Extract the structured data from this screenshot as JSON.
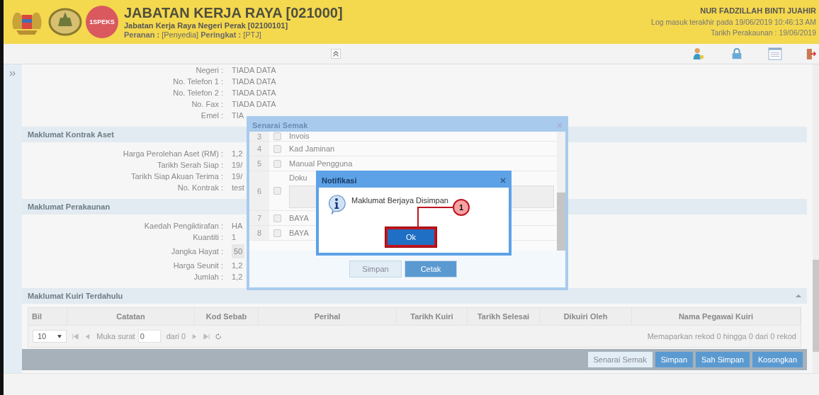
{
  "header": {
    "logo_text": "1SPEKS",
    "title": "JABATAN KERJA RAYA [021000]",
    "subtitle": "Jabatan Kerja Raya Negeri Perak [02100101]",
    "role_line": "**Peranan :** [Penyedia] **Peringkat :** [PTJ]",
    "user": "NUR FADZILLAH BINTI JUAHIR",
    "last_login": "Log masuk terakhir pada 19/06/2019 10:46:13 AM",
    "account_date": "Tarikh Perakaunan : 19/06/2019"
  },
  "sections": [
    {
      "fields": [
        {
          "label": "Negeri :",
          "value": "TIADA DATA",
          "kind": "text"
        },
        {
          "label": "No. Telefon 1 :",
          "value": "TIADA DATA",
          "kind": "text"
        },
        {
          "label": "No. Telefon 2 :",
          "value": "TIADA DATA",
          "kind": "text"
        },
        {
          "label": "No. Fax :",
          "value": "TIADA DATA",
          "kind": "text"
        },
        {
          "label": "Emel :",
          "value": "TIA",
          "kind": "text"
        }
      ]
    },
    {
      "title": "Maklumat Kontrak Aset",
      "fields": [
        {
          "label": "Harga Perolehan Aset (RM) :",
          "value": "1,2",
          "kind": "text"
        },
        {
          "label": "Tarikh Serah Siap :",
          "value": "19/",
          "kind": "text"
        },
        {
          "label": "Tarikh Siap Akuan Terima :",
          "value": "19/",
          "kind": "text"
        },
        {
          "label": "No. Kontrak :",
          "value": "test",
          "kind": "text"
        }
      ]
    },
    {
      "title": "Maklumat Perakaunan",
      "fields": [
        {
          "label": "Kaedah Pengiktirafan :",
          "value": "HA",
          "kind": "text"
        },
        {
          "label": "Kuantiti :",
          "value": "1",
          "kind": "text"
        },
        {
          "label": "Jangka Hayat :",
          "value": "50",
          "kind": "input"
        },
        {
          "label": "Harga Seunit :",
          "value": "1,2",
          "kind": "text"
        },
        {
          "label": "Jumlah :",
          "value": "1,2",
          "kind": "text"
        }
      ]
    }
  ],
  "query": {
    "title": "Maklumat Kuiri Terdahulu",
    "columns": [
      "Bil",
      "Catatan",
      "Kod Sebab",
      "Perihal",
      "Tarikh Kuiri",
      "Tarikh Selesai",
      "Dikuiri Oleh",
      "Nama Pegawai Kuiri"
    ],
    "pager": {
      "page_size": "10",
      "page_label": "Muka surat",
      "page_value": "0",
      "of_label": "dari 0",
      "summary": "Memaparkan rekod 0 hingga 0 dari 0 rekod"
    }
  },
  "actions": [
    {
      "label": "Senarai Semak",
      "kind": "secondary"
    },
    {
      "label": "Simpan",
      "kind": "primary"
    },
    {
      "label": "Sah Simpan",
      "kind": "primary"
    },
    {
      "label": "Kosongkan",
      "kind": "primary"
    }
  ],
  "checklist": {
    "title": "Senarai Semak",
    "items": [
      {
        "number": "3",
        "label": "Invois",
        "checked": false,
        "kind": "line"
      },
      {
        "number": "4",
        "label": "Kad Jaminan",
        "checked": false,
        "kind": "line"
      },
      {
        "number": "5",
        "label": "Manual Pengguna",
        "checked": false,
        "kind": "line"
      },
      {
        "number": "6",
        "label": "Doku",
        "checked": false,
        "kind": "textarea"
      },
      {
        "number": "7",
        "label": "BAYA",
        "checked": false,
        "kind": "line"
      },
      {
        "number": "8",
        "label": "BAYA",
        "checked": false,
        "kind": "line"
      }
    ],
    "buttons": [
      {
        "label": "Simpan",
        "kind": "secondary"
      },
      {
        "label": "Cetak",
        "kind": "primary"
      }
    ]
  },
  "notification": {
    "title": "Notifikasi",
    "message": "Maklumat Berjaya Disimpan",
    "button": "Ok",
    "callout": "1"
  }
}
